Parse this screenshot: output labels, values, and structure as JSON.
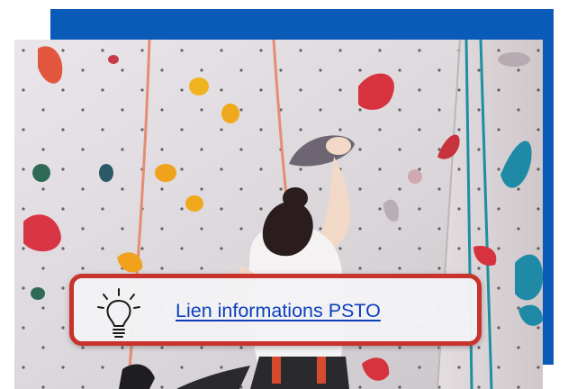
{
  "info_card": {
    "link_label": "Lien informations PSTO",
    "icon": "lightbulb-icon",
    "border_color": "#c8332c",
    "link_color": "#0d3fbd"
  },
  "panel": {
    "accent_color": "#0a5ab8"
  },
  "photo": {
    "subject": "climbing-wall-image"
  }
}
